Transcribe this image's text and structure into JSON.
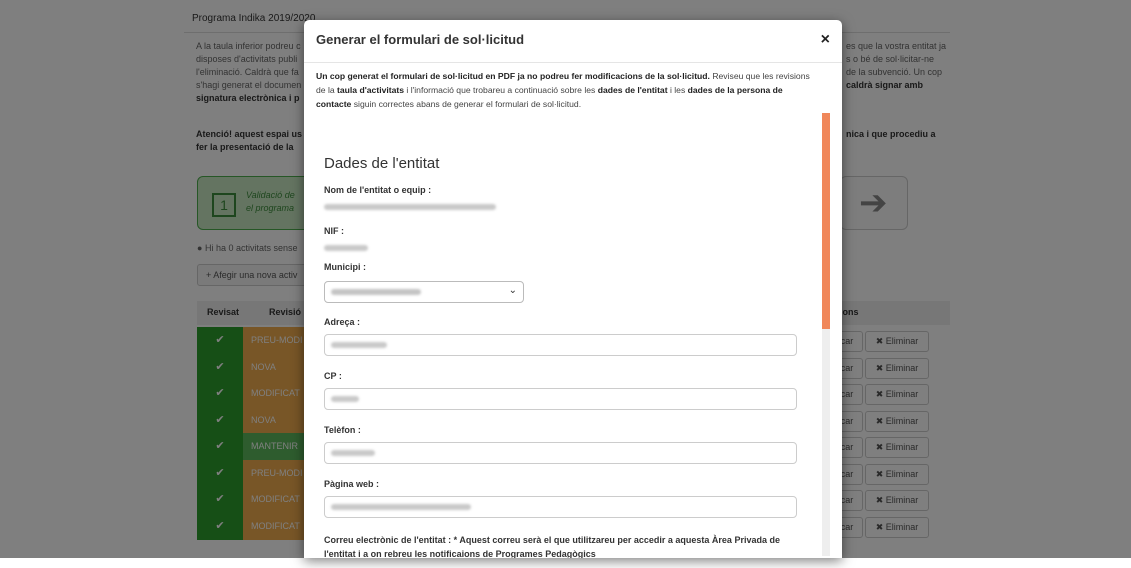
{
  "background": {
    "header": "Programa Indika 2019/2020",
    "left_text": [
      "A la taula inferior podreu c",
      "disposes d'activitats publi",
      "l'eliminació. Caldrà que fa",
      "s'hagi generat el documen",
      "signatura electrònica i p"
    ],
    "right_text": [
      "es que la vostra entitat ja",
      "s o bé de sol·licitar-ne",
      "de la subvenció. Un cop",
      "caldrà signar amb"
    ],
    "attention_left": [
      "Atenció! aquest espai us",
      "fer la presentació de la"
    ],
    "attention_right": "nica i que procediu a",
    "step_number": "1",
    "step_text": [
      "Validació de",
      "el programa"
    ],
    "arrow": "➔",
    "info": "Hi ha 0 activitats sense",
    "add_button": "Afegir una nova activ",
    "table": {
      "col_revisat": "Revisat",
      "col_revisio": "Revisió",
      "col_actions": "ions",
      "rows": [
        {
          "status": "PREU-MODI",
          "color": "orange"
        },
        {
          "status": "NOVA",
          "color": "orange"
        },
        {
          "status": "MODIFICAT",
          "color": "orange"
        },
        {
          "status": "NOVA",
          "color": "orange"
        },
        {
          "status": "MANTENIR",
          "color": "green"
        },
        {
          "status": "PREU-MODI",
          "color": "orange"
        },
        {
          "status": "MODIFICAT",
          "color": "orange"
        },
        {
          "status": "MODIFICAT",
          "color": "orange"
        }
      ],
      "check": "✔",
      "modify_label": "icar",
      "delete_label": "✖ Eliminar"
    }
  },
  "modal": {
    "title": "Generar el formulari de sol·licitud",
    "close": "×",
    "intro": {
      "b1": "Un cop generat el formulari de sol·licitud en PDF ja no podreu fer modificacions de la sol·licitud.",
      "t1": " Reviseu que les revisions de la ",
      "b2": "taula d'activitats",
      "t2": " i l'informació que trobareu a continuació sobre les ",
      "b3": "dades de l'entitat",
      "t3": " i les ",
      "b4": "dades de la persona de contacte",
      "t4": " siguin correctes abans de generar el formulari de sol·licitud."
    },
    "section_title": "Dades de l'entitat",
    "fields": {
      "nom": "Nom de l'entitat o equip :",
      "nif": "NIF :",
      "municipi": "Municipi :",
      "adreca": "Adreça :",
      "cp": "CP :",
      "telefon": "Telèfon :",
      "web": "Pàgina web :",
      "correu": "Correu electrònic de l'entitat : * Aquest correu serà el que utilitzareu per accedir a aquesta Àrea Privada de l'entitat i a on rebreu les notificaions de Programes Pedagògics"
    },
    "scroll_color": "#f0875a"
  }
}
